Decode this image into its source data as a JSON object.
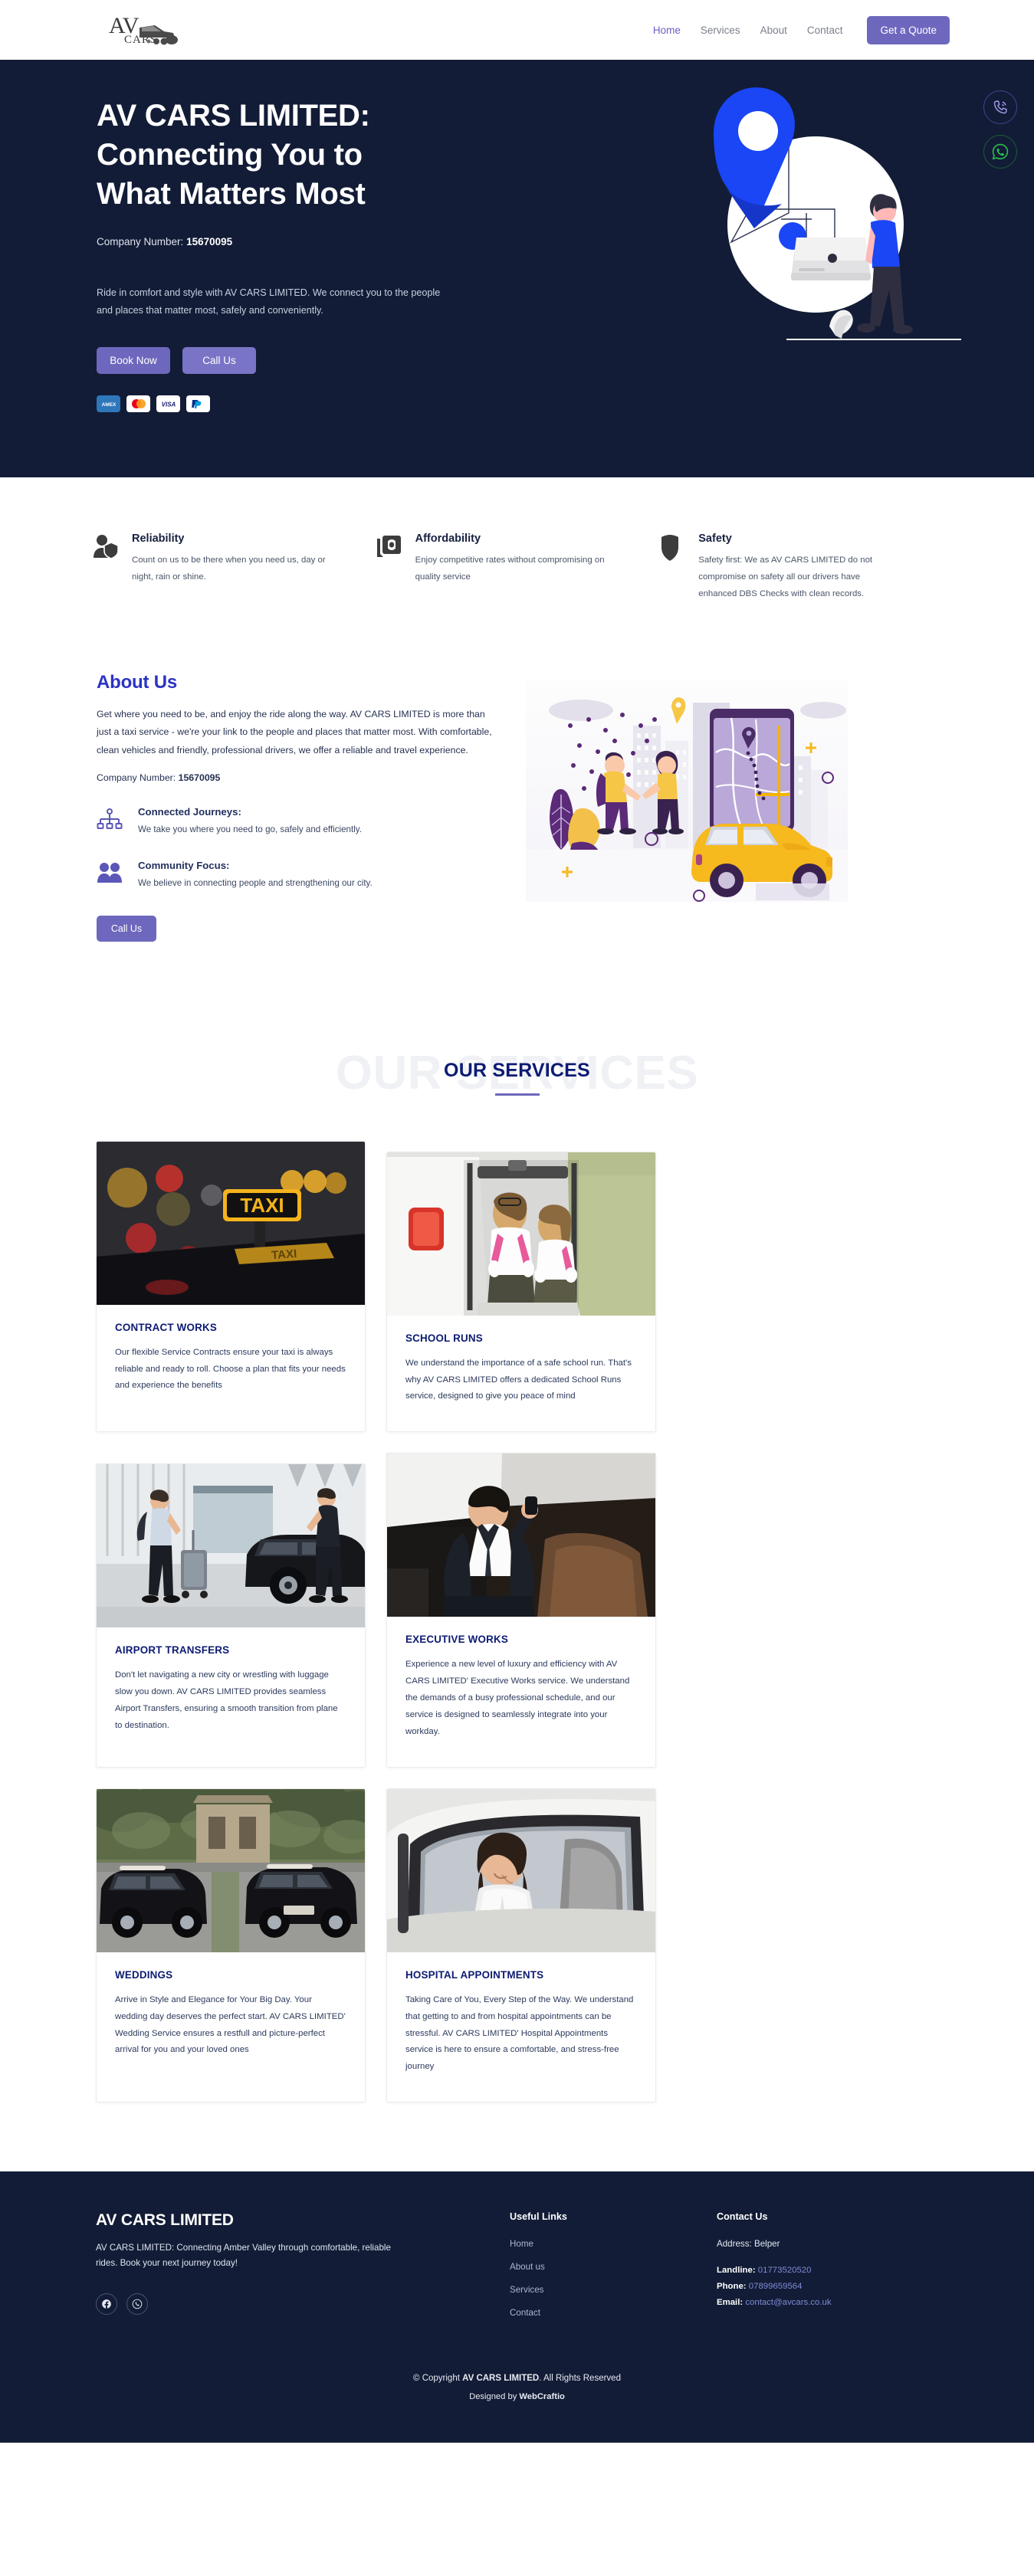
{
  "header": {
    "logo_text_primary": "AV",
    "logo_text_secondary": "CARS",
    "nav": [
      {
        "label": "Home",
        "active": true
      },
      {
        "label": "Services",
        "active": false
      },
      {
        "label": "About",
        "active": false
      },
      {
        "label": "Contact",
        "active": false
      }
    ],
    "quote_button": "Get a Quote"
  },
  "hero": {
    "title_line1": "AV CARS LIMITED:",
    "title_line2": "Connecting You to",
    "title_line3": "What Matters Most",
    "company_label": "Company Number:",
    "company_number": "15670095",
    "description": "Ride in comfort and style with AV CARS LIMITED. We connect you to the people and places that matter most, safely and conveniently.",
    "book_button": "Book Now",
    "call_button": "Call Us",
    "payments": [
      "AMEX",
      "Mastercard",
      "VISA",
      "PayPal"
    ],
    "floating_phone_icon": "phone-icon",
    "floating_whatsapp_icon": "whatsapp-icon"
  },
  "features": [
    {
      "icon": "user-shield-icon",
      "title": "Reliability",
      "text": "Count on us to be there when you need us, day or night, rain or shine."
    },
    {
      "icon": "money-icon",
      "title": "Affordability",
      "text": "Enjoy competitive rates without compromising on quality service"
    },
    {
      "icon": "shield-icon",
      "title": "Safety",
      "text": "Safety first: We as AV CARS LIMITED do not compromise on safety all our drivers have enhanced DBS Checks with clean records."
    }
  ],
  "about": {
    "title": "About Us",
    "paragraph": "Get where you need to be, and enjoy the ride along the way. AV CARS LIMITED is more than just a taxi service - we're your link to the people and places that matter most. With comfortable, clean vehicles and friendly, professional drivers, we offer a reliable and travel experience.",
    "company_label": "Company Number:",
    "company_number": "15670095",
    "points": [
      {
        "icon": "sitemap-icon",
        "title": "Connected Journeys:",
        "text": "We take you where you need to go, safely and efficiently."
      },
      {
        "icon": "users-icon",
        "title": "Community Focus:",
        "text": "We believe in connecting people and strengthening our city."
      }
    ],
    "call_button": "Call Us"
  },
  "services": {
    "ghost_title": "OUR SERVICES",
    "title": "OUR SERVICES",
    "cards": [
      {
        "image": "taxi-sign-photo",
        "title": "CONTRACT WORKS",
        "text": "Our flexible Service Contracts ensure your taxi is always reliable and ready to roll. Choose a plan that fits your needs and experience the benefits"
      },
      {
        "image": "school-children-photo",
        "title": "SCHOOL RUNS",
        "text": "We understand the importance of a safe school run. That's why AV CARS LIMITED offers a dedicated School Runs service, designed to give you peace of mind"
      },
      {
        "image": "airport-transfer-photo",
        "title": "AIRPORT TRANSFERS",
        "text": "Don't let navigating a new city or wrestling with luggage slow you down. AV CARS LIMITED provides seamless Airport Transfers, ensuring a smooth transition from plane to destination."
      },
      {
        "image": "executive-passenger-photo",
        "title": "EXECUTIVE WORKS",
        "text": "Experience a new level of luxury and efficiency with AV CARS LIMITED' Executive Works service. We understand the demands of a busy professional schedule, and our service is designed to seamlessly integrate into your workday."
      },
      {
        "image": "wedding-cars-photo",
        "title": "WEDDINGS",
        "text": "Arrive in Style and Elegance for Your Big Day. Your wedding day deserves the perfect start. AV CARS LIMITED' Wedding Service ensures a restfull and picture-perfect arrival for you and your loved ones"
      },
      {
        "image": "hospital-passenger-photo",
        "title": "HOSPITAL APPOINTMENTS",
        "text": "Taking Care of You, Every Step of the Way. We understand that getting to and from hospital appointments can be stressful. AV CARS LIMITED' Hospital Appointments service is here to ensure a comfortable, and stress-free journey"
      }
    ]
  },
  "footer": {
    "brand_title": "AV CARS LIMITED",
    "brand_text": "AV CARS LIMITED: Connecting Amber Valley through comfortable, reliable rides. Book your next journey today!",
    "socials": [
      {
        "icon": "facebook-icon"
      },
      {
        "icon": "whatsapp-icon"
      }
    ],
    "links_heading": "Useful Links",
    "links": [
      "Home",
      "About us",
      "Services",
      "Contact"
    ],
    "contact_heading": "Contact Us",
    "address": "Address: Belper",
    "landline_label": "Landline:",
    "landline_value": "01773520520",
    "phone_label": "Phone:",
    "phone_value": "07899659564",
    "email_label": "Email:",
    "email_value": "contact@avcars.co.uk",
    "copyright_pre": "© Copyright ",
    "copyright_brand": "AV CARS LIMITED",
    "copyright_post": ". All Rights Reserved",
    "designed_pre": "Designed by ",
    "designed_brand": "WebCraftio"
  },
  "colors": {
    "navy": "#121c36",
    "purple": "#6d68bd",
    "blue": "#2b33c4",
    "card_title": "#0d1b73",
    "whatsapp_green": "#25d366"
  }
}
